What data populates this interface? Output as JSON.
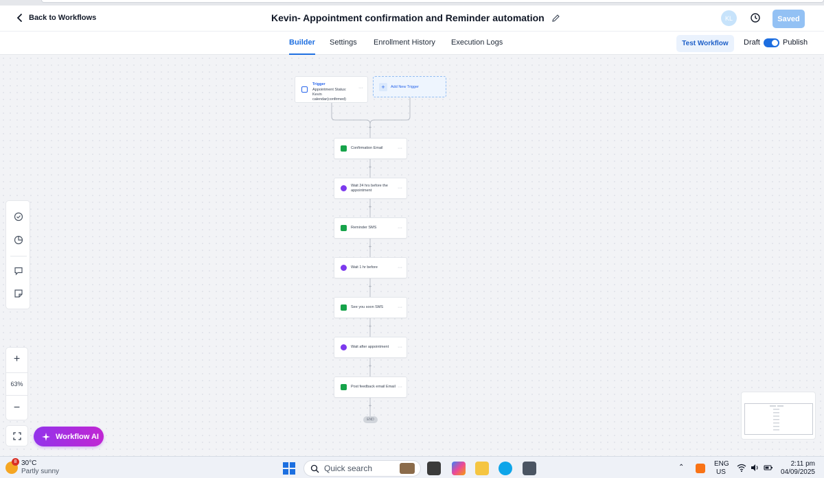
{
  "header": {
    "back_label": "Back to Workflows",
    "title": "Kevin- Appointment confirmation and Reminder automation",
    "avatar_initials": "KL",
    "saved_label": "Saved"
  },
  "tabs": [
    {
      "label": "Builder",
      "active": true
    },
    {
      "label": "Settings",
      "active": false
    },
    {
      "label": "Enrollment History",
      "active": false
    },
    {
      "label": "Execution Logs",
      "active": false
    }
  ],
  "actions": {
    "test_workflow": "Test Workflow",
    "draft_label": "Draft",
    "publish_label": "Publish",
    "publish_on": true
  },
  "trigger": {
    "title": "Trigger",
    "description": "Appointment Status: Kevin calendar(confirmed)",
    "menu": "···"
  },
  "add_trigger": {
    "label": "Add New Trigger"
  },
  "steps": [
    {
      "label": "Confirmation Email",
      "icon": "email-icon",
      "menu": "···"
    },
    {
      "label": "Wait 24 hrs before the appointment",
      "icon": "clock-icon",
      "menu": "···"
    },
    {
      "label": "Reminder SMS",
      "icon": "sms-icon",
      "menu": "···"
    },
    {
      "label": "Wait 1 hr before",
      "icon": "clock-icon",
      "menu": "···"
    },
    {
      "label": "See you soon SMS",
      "icon": "sms-icon",
      "menu": "···"
    },
    {
      "label": "Wait after appointment",
      "icon": "clock-icon",
      "menu": "···"
    },
    {
      "label": "Post feedback email Email",
      "icon": "email-icon",
      "menu": "···"
    }
  ],
  "end_label": "END",
  "zoom": {
    "level": "63%",
    "plus": "+",
    "minus": "−"
  },
  "ai_button": {
    "label": "Workflow AI"
  },
  "taskbar": {
    "temperature": "30°C",
    "condition": "Partly sunny",
    "weather_badge": "8",
    "search_placeholder": "Quick search",
    "lang_top": "ENG",
    "lang_bottom": "US",
    "time": "2:11 pm",
    "date": "04/09/2025"
  },
  "colors": {
    "accent": "#1d6ee0",
    "ai_gradient_start": "#9333ea",
    "ai_gradient_end": "#c026d3",
    "email_green": "#16a34a",
    "wait_purple": "#7c3aed"
  }
}
